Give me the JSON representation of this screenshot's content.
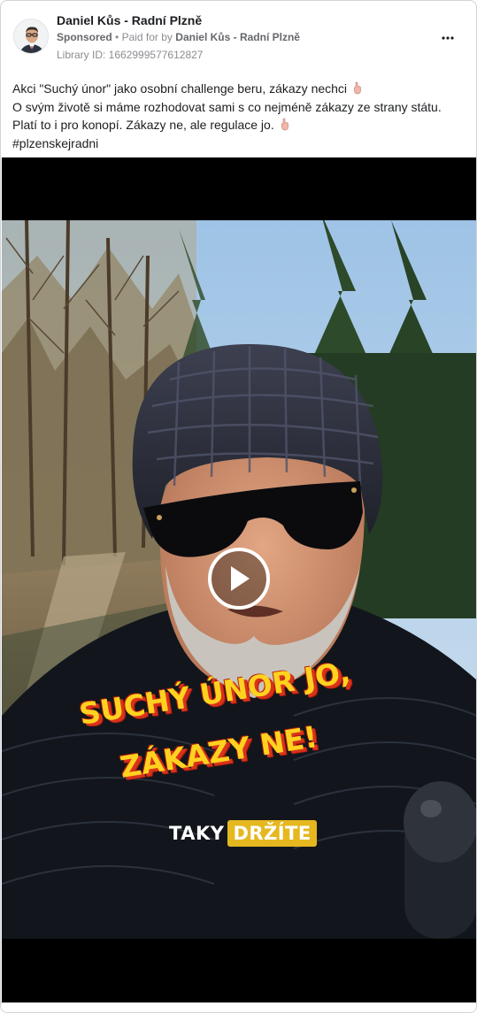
{
  "ad": {
    "page_name": "Daniel Kůs - Radní Plzně",
    "sponsored_label": "Sponsored",
    "paid_for_prefix": "Paid for by",
    "paid_for_name": "Daniel Kůs - Radní Plzně",
    "library_id": "Library ID: 1662999577612827",
    "more_icon": "more-horizontal-icon"
  },
  "body": {
    "lines": [
      "Akci \"Suchý únor\" jako osobní challenge beru, zákazy nechci",
      "O svým životě si máme rozhodovat sami s co nejméně zákazy ze strany státu.",
      "Platí to i pro konopí. Zákazy ne, ale regulace jo.",
      "#plzenskejradni"
    ],
    "emoji": "hand-emoji-icon"
  },
  "video": {
    "overlay_line1": "SUCHÝ ÚNOR JO,",
    "overlay_line2": "ZÁKAZY NE!",
    "tag_left": "TAKY",
    "tag_right": "DRŽÍTE",
    "play_icon": "play-icon",
    "colors": {
      "overlay_text": "#ffd21f",
      "overlay_shadow": "#d9331c",
      "tag_highlight": "#e5b820"
    }
  }
}
